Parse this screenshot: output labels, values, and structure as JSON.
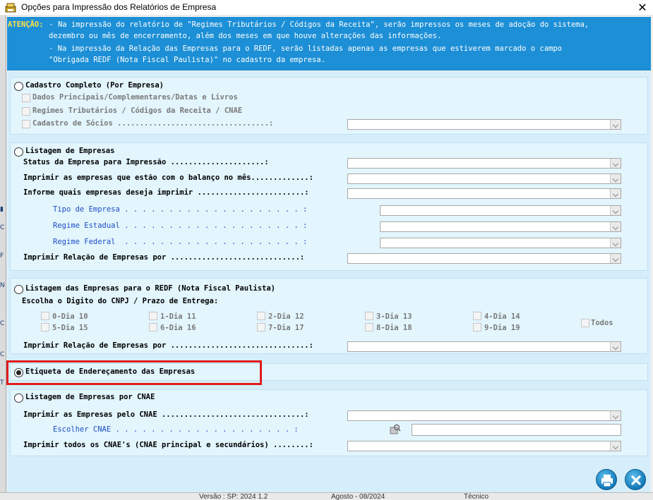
{
  "window": {
    "title": "Opções para Impressão dos Relatórios de Empresa",
    "close_glyph": "✕"
  },
  "banner": {
    "atencao": "ATENÇÃO:",
    "line1": " - Na impressão do relatório de \"Regimes Tributários / Códigos da Receita\", serão impressos os meses de adoção do sistema,",
    "line2": "dezembro ou mês de encerramento, além dos meses em que houve alterações das informações.",
    "line3": "- Na impressão da Relação das Empresas para o REDF, serão listadas apenas as empresas que estiverem marcado o campo",
    "line4": "\"Obrigada REDF (Nota Fiscal Paulista)\" no cadastro da empresa."
  },
  "cadastro": {
    "title": "Cadastro Completo (Por Empresa)",
    "opt1": "Dados Principais/Complementares/Datas e Livros",
    "opt2": "Regimes Tributários / Códigos da Receita / CNAE",
    "opt3": "Cadastro de Sócios ..................................:"
  },
  "listagem": {
    "title": "Listagem de Empresas",
    "status": "Status da Empresa para Impressão .....................:",
    "balanco": "Imprimir as empresas que estão com o balanço no mês.............:",
    "informe": "Informe quais empresas deseja imprimir ........................:",
    "tipo": "Tipo de Empresa . . . . . . . . . . . . . . . . . . . . :",
    "estadual": "Regime Estadual . . . . . . . . . . . . . . . . . . . . :",
    "federal": "Regime Federal  . . . . . . . . . . . . . . . . . . . . :",
    "relacao": "Imprimir Relação de Empresas por .............................:"
  },
  "redf": {
    "title": "Listagem das Empresas para o REDF (Nota Fiscal Paulista)",
    "subtitle": "Escolha o Digito do CNPJ / Prazo de Entrega:",
    "digits": [
      "0-Dia 10",
      "1-Dia 11",
      "2-Dia 12",
      "3-Dia 13",
      "4-Dia 14",
      "5-Dia 15",
      "6-Dia 16",
      "7-Dia 17",
      "8-Dia 18",
      "9-Dia 19"
    ],
    "todos": "Todos",
    "relacao": "Imprimir Relação de Empresas por ...............................:"
  },
  "etiqueta": {
    "title": "Etiqueta de Endereçamento das Empresas"
  },
  "cnae": {
    "title": "Listagem de Empresas por CNAE",
    "pelo": "Imprimir as Empresas pelo CNAE ................................:",
    "escolher": "Escolher CNAE . . . . . . . . . . . . . . . . . . . . :",
    "todos": "Imprimir todos os CNAE's (CNAE principal e secundários) ........:"
  },
  "taskbar": {
    "versao": "Versão : SP: 2024 1.2",
    "agosto": "Agosto - 08/2024",
    "tecnico": "Técnico"
  },
  "colors": {
    "banner": "#1c8fd6",
    "atencao": "#ffe24a",
    "panel": "#e3f5fd",
    "highlight": "#e01b1b"
  },
  "selected_option": "etiqueta"
}
